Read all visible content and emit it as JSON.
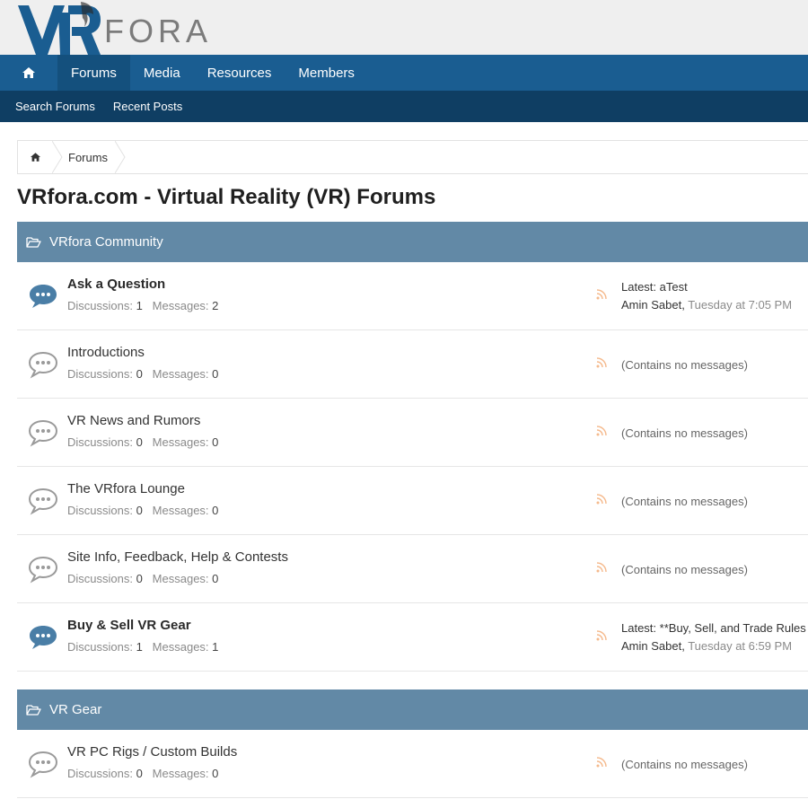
{
  "brand": {
    "logo_text": "VRFORA"
  },
  "nav": {
    "home_icon": "home-icon",
    "items": [
      {
        "label": "Forums"
      },
      {
        "label": "Media"
      },
      {
        "label": "Resources"
      },
      {
        "label": "Members"
      }
    ]
  },
  "subnav": {
    "items": [
      {
        "label": "Search Forums"
      },
      {
        "label": "Recent Posts"
      }
    ]
  },
  "breadcrumb": {
    "home_icon": "home-icon",
    "current": "Forums"
  },
  "page": {
    "title": "VRfora.com - Virtual Reality (VR) Forums"
  },
  "labels": {
    "discussions": "Discussions:",
    "messages": "Messages:",
    "latest": "Latest:",
    "no_messages": "(Contains no messages)"
  },
  "colors": {
    "nav_bg": "#1a5d91",
    "nav_active": "#14507d",
    "subnav_bg": "#0f3e63",
    "category_bg": "#6289a6",
    "bubble_unread": "#4a7ea6",
    "bubble_read": "#9a9a9a",
    "rss": "#f5b98c"
  },
  "categories": [
    {
      "title": "VRfora Community",
      "forums": [
        {
          "title": "Ask a Question",
          "discussions": "1",
          "messages": "2",
          "latest_title": "aTest",
          "latest_user": "Amin Sabet",
          "latest_time": "Tuesday at 7:05 PM"
        },
        {
          "title": "Introductions",
          "discussions": "0",
          "messages": "0"
        },
        {
          "title": "VR News and Rumors",
          "discussions": "0",
          "messages": "0"
        },
        {
          "title": "The VRfora Lounge",
          "discussions": "0",
          "messages": "0"
        },
        {
          "title": "Site Info, Feedback, Help & Contests",
          "discussions": "0",
          "messages": "0"
        },
        {
          "title": "Buy & Sell VR Gear",
          "discussions": "1",
          "messages": "1",
          "latest_title": "**Buy, Sell, and Trade Rules -...",
          "latest_user": "Amin Sabet",
          "latest_time": "Tuesday at 6:59 PM"
        }
      ]
    },
    {
      "title": "VR Gear",
      "forums": [
        {
          "title": "VR PC Rigs / Custom Builds",
          "discussions": "0",
          "messages": "0"
        }
      ]
    }
  ]
}
